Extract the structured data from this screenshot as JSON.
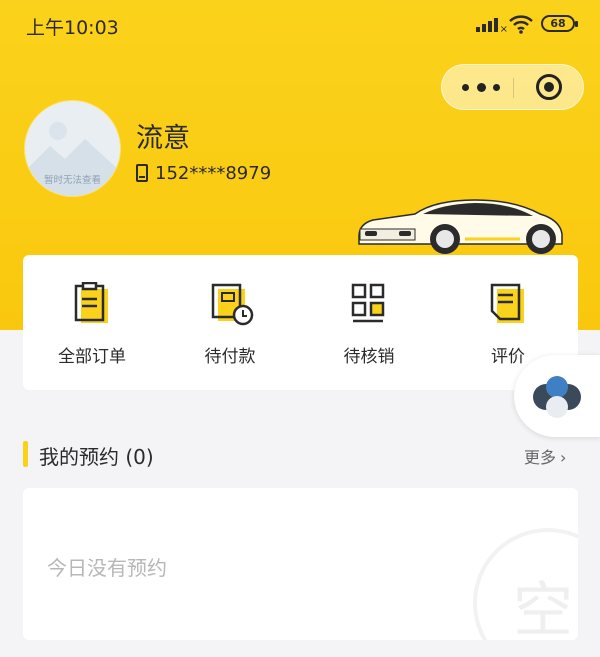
{
  "status_bar": {
    "time": "上午10:03",
    "battery": "68"
  },
  "profile": {
    "avatar_text": "暂时无法查看",
    "name": "流意",
    "phone": "152****8979"
  },
  "menu": [
    {
      "label": "全部订单",
      "icon": "clipboard-icon"
    },
    {
      "label": "待付款",
      "icon": "wallet-clock-icon"
    },
    {
      "label": "待核销",
      "icon": "qr-code-icon"
    },
    {
      "label": "评价",
      "icon": "document-icon"
    }
  ],
  "reservations": {
    "title": "我的预约 (0)",
    "more": "更多",
    "empty": "今日没有预约"
  },
  "colors": {
    "brand_yellow": "#fbd21b",
    "text": "#2b2b2b",
    "muted": "#b7b7b7"
  }
}
